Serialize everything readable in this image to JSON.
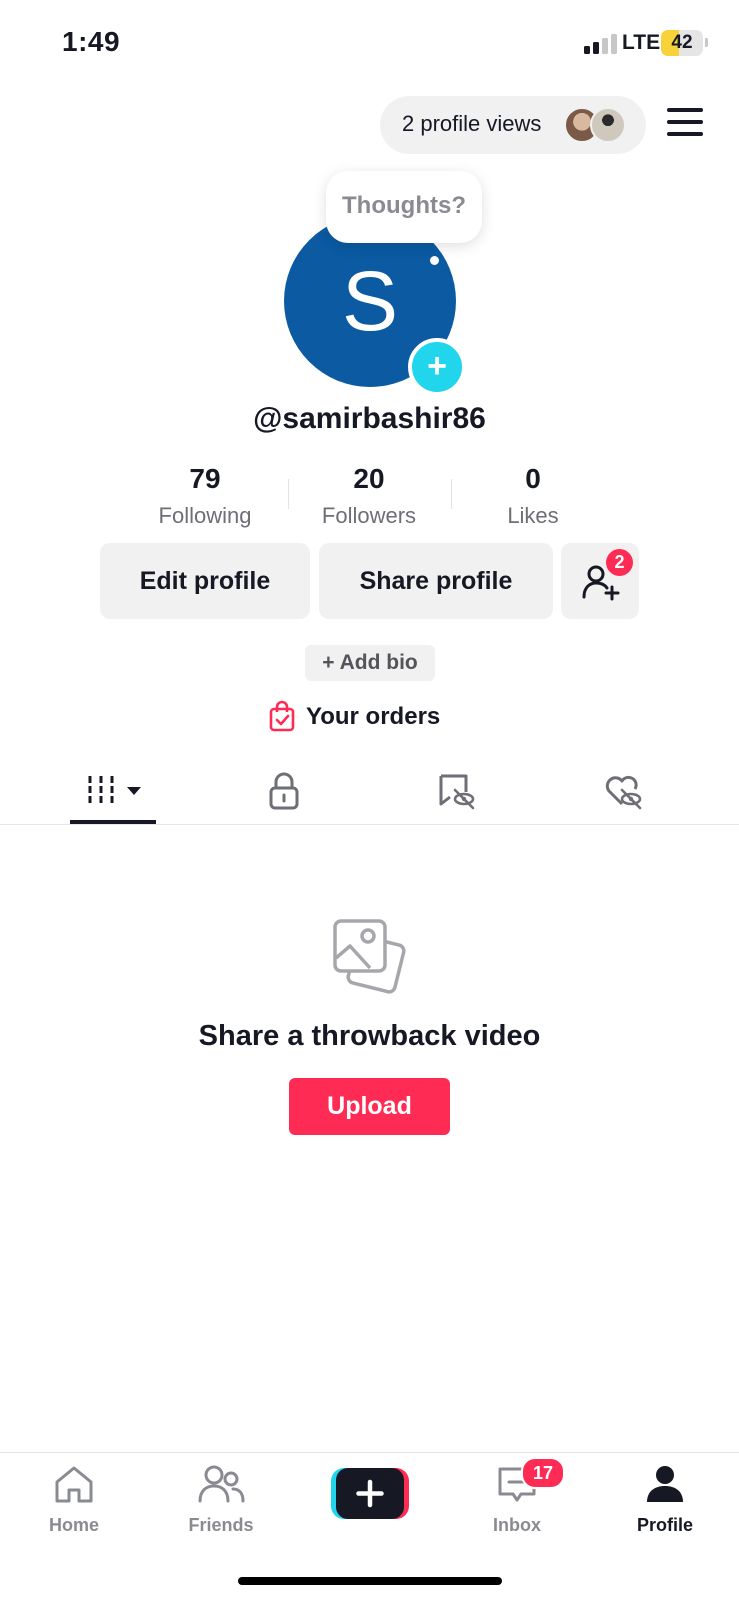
{
  "status_bar": {
    "time": "1:49",
    "network": "LTE",
    "battery": "42",
    "battery_level": 0.42
  },
  "header": {
    "profile_views": "2 profile views"
  },
  "profile": {
    "avatar_letter": "S",
    "avatar_color": "#0b5aa2",
    "thought_bubble": "Thoughts?",
    "username": "@samirbashir86"
  },
  "stats": [
    {
      "value": "79",
      "label": "Following"
    },
    {
      "value": "20",
      "label": "Followers"
    },
    {
      "value": "0",
      "label": "Likes"
    }
  ],
  "actions": {
    "edit_profile": "Edit profile",
    "share_profile": "Share profile",
    "friend_requests_badge": "2"
  },
  "bio": {
    "add_bio": "+ Add bio"
  },
  "orders": {
    "label": "Your orders"
  },
  "tabs": [
    {
      "icon": "videos-grid-icon",
      "active": true
    },
    {
      "icon": "lock-icon",
      "active": false
    },
    {
      "icon": "hidden-tag-icon",
      "active": false
    },
    {
      "icon": "hidden-heart-icon",
      "active": false
    }
  ],
  "empty_state": {
    "title": "Share a throwback video",
    "upload": "Upload"
  },
  "bottom_nav": {
    "home": "Home",
    "friends": "Friends",
    "inbox": "Inbox",
    "inbox_badge": "17",
    "profile": "Profile"
  },
  "colors": {
    "accent": "#fe2c55",
    "teal": "#20d5ec",
    "text": "#161823",
    "muted": "#8a8b91"
  }
}
